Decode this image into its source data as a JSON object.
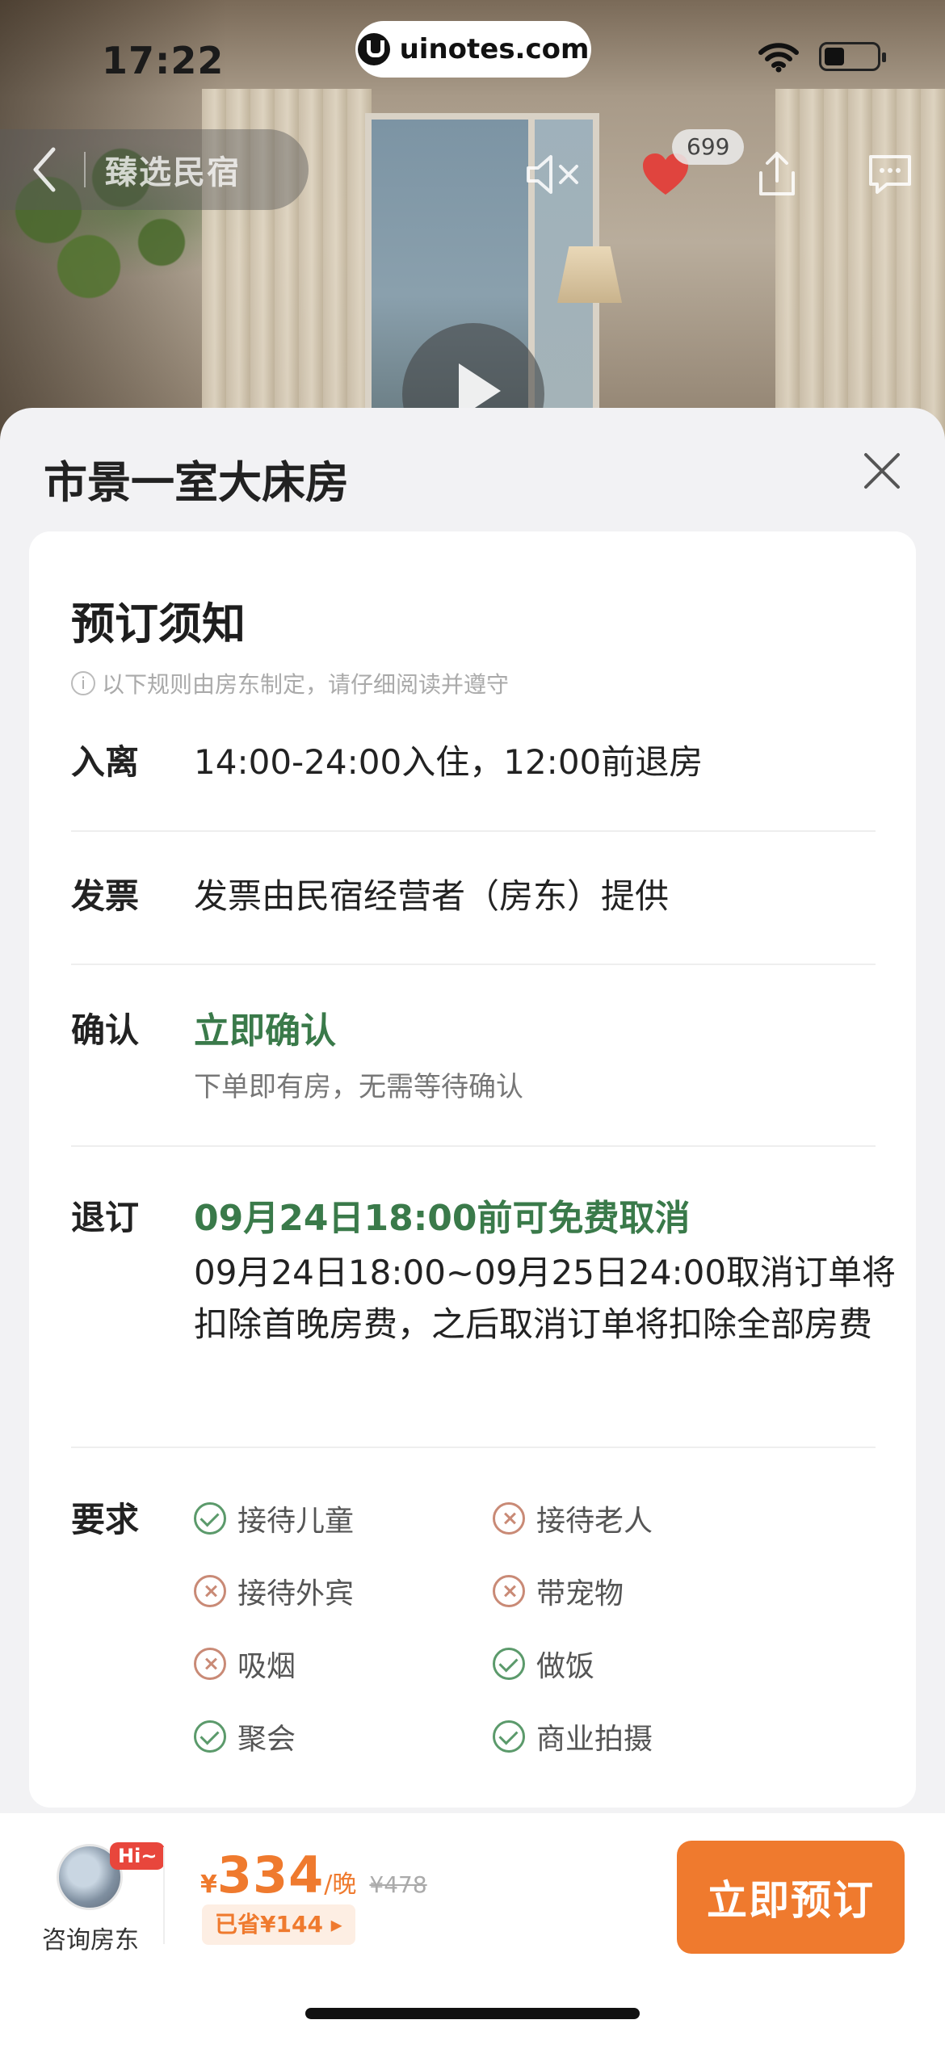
{
  "status_bar": {
    "time": "17:22"
  },
  "watermark": {
    "text": "uinotes.com"
  },
  "nav": {
    "title": "臻选民宿",
    "like_count": "699"
  },
  "sheet": {
    "title": "市景一室大床房"
  },
  "notice": {
    "title": "预订须知",
    "note": "以下规则由房东制定，请仔细阅读并遵守",
    "checkin": {
      "label": "入离",
      "value": "14:00-24:00入住，12:00前退房"
    },
    "invoice": {
      "label": "发票",
      "value": "发票由民宿经营者（房东）提供"
    },
    "confirm": {
      "label": "确认",
      "value": "立即确认",
      "sub": "下单即有房，无需等待确认"
    },
    "cancel": {
      "label": "退订",
      "value": "09月24日18:00前可免费取消",
      "detail": "09月24日18:00~09月25日24:00取消订单将扣除首晚房费，之后取消订单将扣除全部房费"
    },
    "requirements": {
      "label": "要求",
      "items": [
        {
          "text": "接待儿童",
          "allowed": true
        },
        {
          "text": "接待老人",
          "allowed": false
        },
        {
          "text": "接待外宾",
          "allowed": false
        },
        {
          "text": "带宠物",
          "allowed": false
        },
        {
          "text": "吸烟",
          "allowed": false
        },
        {
          "text": "做饭",
          "allowed": true
        },
        {
          "text": "聚会",
          "allowed": true
        },
        {
          "text": "商业拍摄",
          "allowed": true
        }
      ]
    }
  },
  "bottom_bar": {
    "hi_badge": "Hi~",
    "consult_label": "咨询房东",
    "currency": "¥",
    "price": "334",
    "unit": "/晚",
    "original_price": "¥478",
    "saved": "已省¥144 ▸",
    "book_label": "立即预订"
  },
  "colors": {
    "accent_orange": "#ef7a2e",
    "confirm_green": "#3a7a4a",
    "ok_icon": "#5b9a6b",
    "no_icon": "#c98a76"
  }
}
